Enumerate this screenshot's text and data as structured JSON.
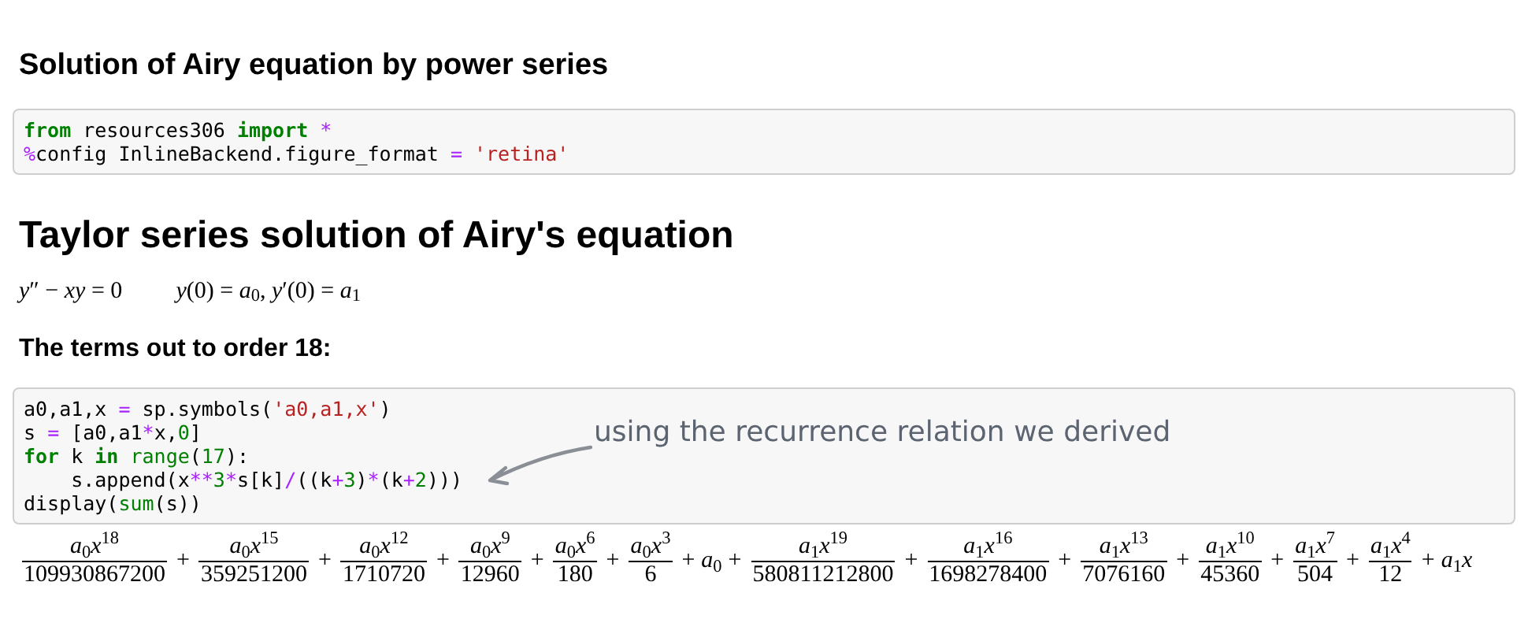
{
  "heading_1": "Solution of Airy equation by power series",
  "code_cell_1": {
    "lines": [
      [
        {
          "kind": "kw",
          "text": "from"
        },
        {
          "kind": "plain",
          "text": " resources306 "
        },
        {
          "kind": "kw",
          "text": "import"
        },
        {
          "kind": "op",
          "text": " *"
        }
      ],
      [
        {
          "kind": "magic",
          "text": "%"
        },
        {
          "kind": "plain",
          "text": "config InlineBackend.figure_format "
        },
        {
          "kind": "op",
          "text": "="
        },
        {
          "kind": "str",
          "text": " 'retina'"
        }
      ]
    ]
  },
  "heading_2": "Taylor series solution of Airy's equation",
  "equations": [
    "*y*″ − *xy* = 0",
    "*y*(0) = *a*$_{0}$,  *y*′(0) = *a*$_{1}$"
  ],
  "heading_3": "The terms out to order 18:",
  "code_cell_2": {
    "lines": [
      [
        {
          "kind": "plain",
          "text": "a0,a1,x "
        },
        {
          "kind": "op",
          "text": "="
        },
        {
          "kind": "plain",
          "text": " sp.symbols("
        },
        {
          "kind": "str",
          "text": "'a0,a1,x'"
        },
        {
          "kind": "plain",
          "text": ")"
        }
      ],
      [
        {
          "kind": "plain",
          "text": "s "
        },
        {
          "kind": "op",
          "text": "="
        },
        {
          "kind": "plain",
          "text": " [a0,a1"
        },
        {
          "kind": "op",
          "text": "*"
        },
        {
          "kind": "plain",
          "text": "x,"
        },
        {
          "kind": "num",
          "text": "0"
        },
        {
          "kind": "plain",
          "text": "]"
        }
      ],
      [
        {
          "kind": "kw",
          "text": "for"
        },
        {
          "kind": "plain",
          "text": " k "
        },
        {
          "kind": "kw",
          "text": "in"
        },
        {
          "kind": "builtin",
          "text": " range"
        },
        {
          "kind": "plain",
          "text": "("
        },
        {
          "kind": "num",
          "text": "17"
        },
        {
          "kind": "plain",
          "text": "):"
        }
      ],
      [
        {
          "kind": "plain",
          "text": "    s.append(x"
        },
        {
          "kind": "op",
          "text": "**"
        },
        {
          "kind": "num",
          "text": "3"
        },
        {
          "kind": "op",
          "text": "*"
        },
        {
          "kind": "plain",
          "text": "s[k]"
        },
        {
          "kind": "op",
          "text": "/"
        },
        {
          "kind": "plain",
          "text": "((k"
        },
        {
          "kind": "op",
          "text": "+"
        },
        {
          "kind": "num",
          "text": "3"
        },
        {
          "kind": "plain",
          "text": ")"
        },
        {
          "kind": "op",
          "text": "*"
        },
        {
          "kind": "plain",
          "text": "(k"
        },
        {
          "kind": "op",
          "text": "+"
        },
        {
          "kind": "num",
          "text": "2"
        },
        {
          "kind": "plain",
          "text": ")))"
        }
      ],
      [
        {
          "kind": "plain",
          "text": "display("
        },
        {
          "kind": "builtin",
          "text": "sum"
        },
        {
          "kind": "plain",
          "text": "(s))"
        }
      ]
    ],
    "annotation": "using the recurrence relation we derived"
  },
  "output": [
    {
      "kind": "frac",
      "num": "*a*$_{0}$*x*$^{18}$",
      "den": "109930867200"
    },
    {
      "kind": "op",
      "text": "+"
    },
    {
      "kind": "frac",
      "num": "*a*$_{0}$*x*$^{15}$",
      "den": "359251200"
    },
    {
      "kind": "op",
      "text": "+"
    },
    {
      "kind": "frac",
      "num": "*a*$_{0}$*x*$^{12}$",
      "den": "1710720"
    },
    {
      "kind": "op",
      "text": "+"
    },
    {
      "kind": "frac",
      "num": "*a*$_{0}$*x*$^{9}$",
      "den": "12960"
    },
    {
      "kind": "op",
      "text": "+"
    },
    {
      "kind": "frac",
      "num": "*a*$_{0}$*x*$^{6}$",
      "den": "180"
    },
    {
      "kind": "op",
      "text": "+"
    },
    {
      "kind": "frac",
      "num": "*a*$_{0}$*x*$^{3}$",
      "den": "6"
    },
    {
      "kind": "op",
      "text": "+"
    },
    {
      "kind": "term",
      "text": "*a*$_{0}$"
    },
    {
      "kind": "op",
      "text": "+"
    },
    {
      "kind": "frac",
      "num": "*a*$_{1}$*x*$^{19}$",
      "den": "580811212800"
    },
    {
      "kind": "op",
      "text": "+"
    },
    {
      "kind": "frac",
      "num": "*a*$_{1}$*x*$^{16}$",
      "den": "1698278400"
    },
    {
      "kind": "op",
      "text": "+"
    },
    {
      "kind": "frac",
      "num": "*a*$_{1}$*x*$^{13}$",
      "den": "7076160"
    },
    {
      "kind": "op",
      "text": "+"
    },
    {
      "kind": "frac",
      "num": "*a*$_{1}$*x*$^{10}$",
      "den": "45360"
    },
    {
      "kind": "op",
      "text": "+"
    },
    {
      "kind": "frac",
      "num": "*a*$_{1}$*x*$^{7}$",
      "den": "504"
    },
    {
      "kind": "op",
      "text": "+"
    },
    {
      "kind": "frac",
      "num": "*a*$_{1}$*x*$^{4}$",
      "den": "12"
    },
    {
      "kind": "op",
      "text": "+"
    },
    {
      "kind": "term",
      "text": "*a*$_{1}$*x*"
    }
  ]
}
